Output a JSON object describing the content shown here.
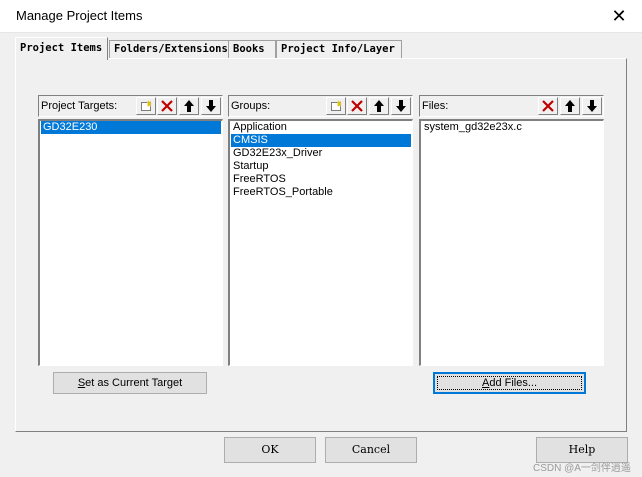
{
  "window": {
    "title": "Manage Project Items",
    "close_glyph": "✕"
  },
  "tabs": [
    {
      "label": "Project Items",
      "active": true
    },
    {
      "label": "Folders/Extensions",
      "active": false
    },
    {
      "label": "Books",
      "active": false
    },
    {
      "label": "Project Info/Layer",
      "active": false
    }
  ],
  "targets": {
    "label": "Project Targets:",
    "items": [
      "GD32E230"
    ],
    "selected": 0,
    "set_current_label": "Set as Current Target",
    "set_current_mnemonic": "S",
    "set_current_rest": "et as Current Target"
  },
  "groups": {
    "label": "Groups:",
    "items": [
      "Application",
      "CMSIS",
      "GD32E23x_Driver",
      "Startup",
      "FreeRTOS",
      "FreeRTOS_Portable"
    ],
    "selected": 1
  },
  "files": {
    "label": "Files:",
    "items": [
      "system_gd32e23x.c"
    ],
    "add_files_label": "Add Files...",
    "add_files_mnemonic": "A",
    "add_files_rest": "dd Files..."
  },
  "icons": {
    "new": "new-item-icon",
    "delete": "delete-icon",
    "up": "move-up-icon",
    "down": "move-down-icon",
    "delete_color": "#c00000"
  },
  "buttons": {
    "ok": "OK",
    "cancel": "Cancel",
    "help": "Help"
  },
  "watermark": "CSDN @A一剑伴逍遥"
}
